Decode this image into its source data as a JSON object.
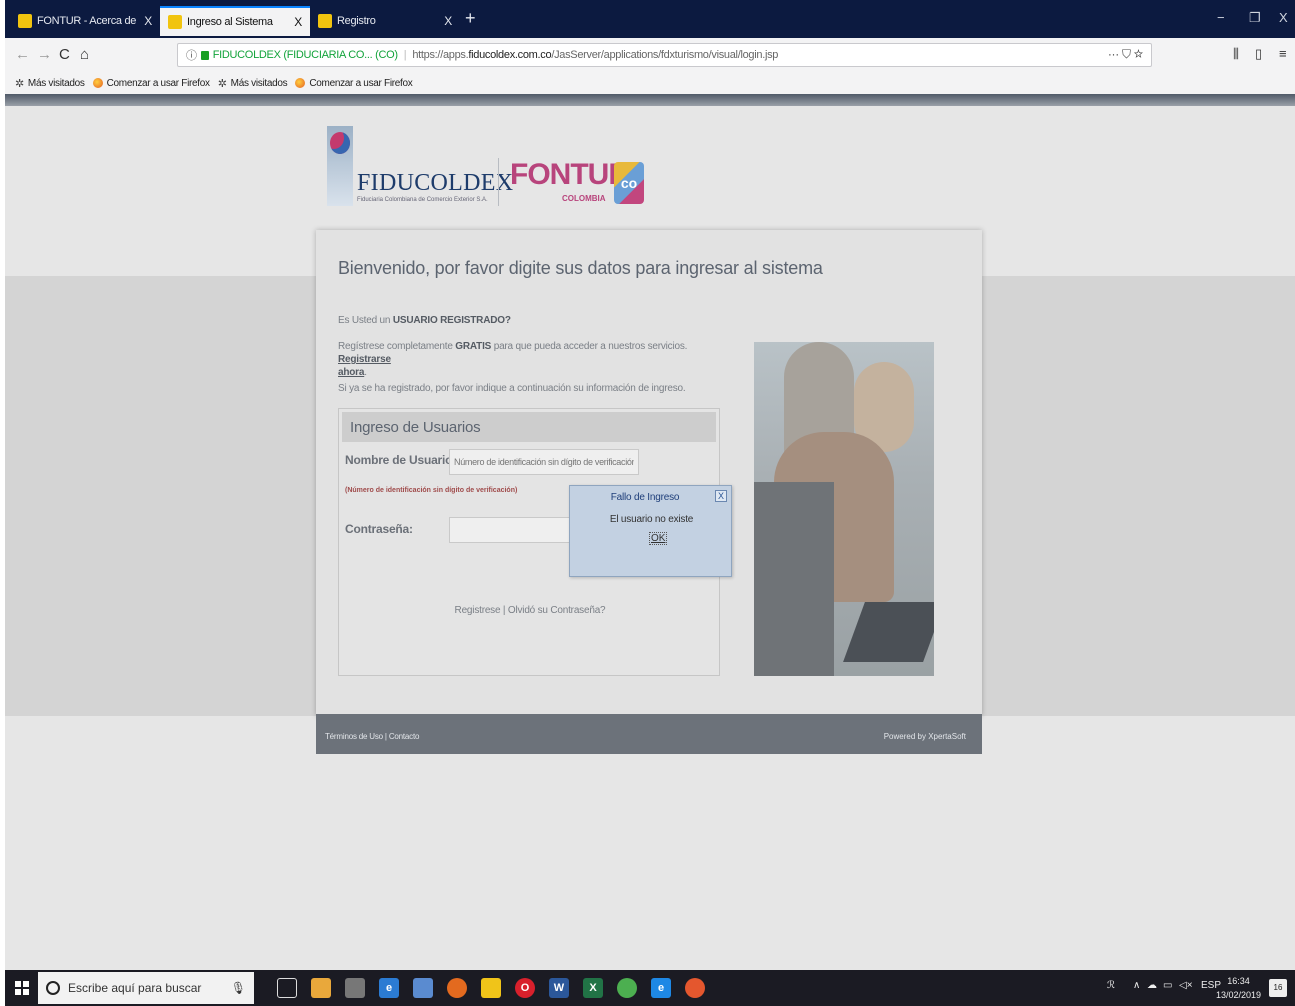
{
  "browser": {
    "tabs": [
      {
        "label": "FONTUR - Acerca de la contrib",
        "active": false
      },
      {
        "label": "Ingreso al Sistema",
        "active": true
      },
      {
        "label": "Registro",
        "active": false
      }
    ],
    "new_tab_symbol": "+",
    "window_controls": {
      "minimize": "−",
      "maximize": "❐",
      "close": "X"
    },
    "nav": {
      "back": "←",
      "forward": "→",
      "reload": "C",
      "home": "⌂"
    },
    "url": {
      "info_symbol": "ⓘ",
      "site_identity": "FIDUCOLDEX (FIDUCIARIA CO... (CO)",
      "prefix": "https://apps.",
      "domain": "fiducoldex.com.co",
      "path": "/JasServer/applications/fdxturismo/visual/login.jsp",
      "actions": "··· ⛉ ☆"
    },
    "toolbar_right": {
      "library": "⫼",
      "sidebar": "▯",
      "menu": "≡"
    },
    "bookmarks": [
      {
        "label": "Más visitados",
        "icon": "gear-icon"
      },
      {
        "label": "Comenzar a usar Firefox",
        "icon": "firefox-icon"
      },
      {
        "label": "Más visitados",
        "icon": "gear-icon"
      },
      {
        "label": "Comenzar a usar Firefox",
        "icon": "firefox-icon"
      }
    ]
  },
  "page": {
    "logo_fiducoldex": {
      "name": "FIDUCOLDEX",
      "tagline": "Fiduciaria Colombiana de Comercio Exterior S.A."
    },
    "logo_fontur": {
      "name": "FONTUR",
      "sub": "COLOMBIA",
      "badge": "co"
    },
    "title": "Bienvenido, por favor digite sus datos para ingresar al sistema",
    "question_prefix": "Es Usted un ",
    "question_bold": "USUARIO REGISTRADO?",
    "register_prefix": "Regístrese completamente ",
    "register_bold": "GRATIS",
    "register_middle": " para que pueda acceder a nuestros servicios. ",
    "register_link_1": "Registrarse",
    "register_link_2": "ahora",
    "register_suffix": ".",
    "already_registered": "Si ya se ha registrado, por favor indique a continuación su información de ingreso.",
    "login": {
      "header": "Ingreso de Usuarios",
      "username_label": "Nombre de Usuario:",
      "username_placeholder": "Número de identificación sin dígito de verificación",
      "username_hint": "(Número de identificación sin dígito de verificación)",
      "password_label": "Contraseña:",
      "links": "Registrese | Olvidó su Contraseña?"
    },
    "footer": {
      "links": "Términos de Uso | Contacto",
      "powered_by": "Powered by XpertaSoft"
    }
  },
  "dialog": {
    "title": "Fallo de Ingreso",
    "close": "X",
    "message": "El usuario no existe",
    "ok": "OK"
  },
  "taskbar": {
    "search_placeholder": "Escribe aquí para buscar",
    "tray_language": "ESP",
    "time": "16:34",
    "date": "13/02/2019",
    "notifications": "16"
  }
}
